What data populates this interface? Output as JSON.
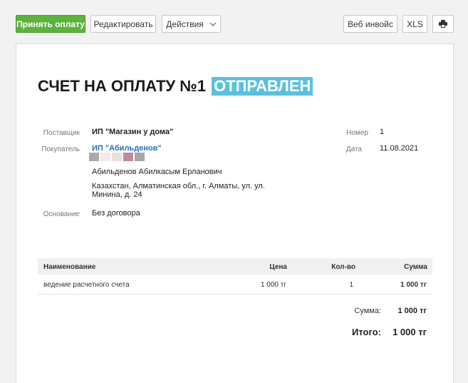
{
  "toolbar": {
    "accept_payment": "Принять оплату",
    "edit": "Редактировать",
    "actions": "Действия",
    "web_invoice": "Веб инвойс",
    "xls": "XLS",
    "print_icon": "printer-icon"
  },
  "invoice": {
    "title": "СЧЕТ НА ОПЛАТУ №1",
    "status": "ОТПРАВЛЕН",
    "status_color": "#5bc0de",
    "supplier_label": "Поставщик",
    "supplier": "ИП \"Магазин у дома\"",
    "buyer_label": "Покупатель",
    "buyer": "ИП \"Абильденов\"",
    "buyer_person": "Абильденов Абилкасым Ерланович",
    "buyer_address_line1": "Казахстан, Алматинская обл., г. Алматы, ул. ул.",
    "buyer_address_line2": "Минина, д. 24",
    "basis_label": "Основание",
    "basis": "Без договора",
    "number_label": "Номер",
    "number": "1",
    "date_label": "Дата",
    "date": "11.08.2021"
  },
  "table": {
    "headers": {
      "name": "Наименование",
      "price": "Цена",
      "qty": "Кол-во",
      "sum": "Сумма"
    },
    "rows": [
      {
        "name": "ведение расчетного счета",
        "price": "1 000 тг",
        "qty": "1",
        "sum": "1 000 тг"
      }
    ]
  },
  "totals": {
    "sum_label": "Сумма:",
    "sum_value": "1 000 тг",
    "total_label": "Итого:",
    "total_value": "1 000 тг"
  },
  "colors": {
    "accent_green": "#5cb23c",
    "link_blue": "#2a6ebb"
  }
}
